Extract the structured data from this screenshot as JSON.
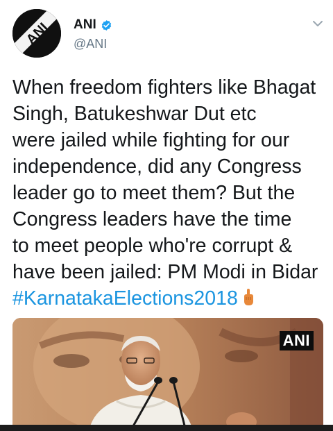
{
  "account": {
    "name": "ANI",
    "handle": "@ANI",
    "avatar_text": "ANI",
    "verified": true
  },
  "tweet": {
    "lines": [
      "When freedom fighters like Bhagat",
      "Singh, Batukeshwar Dut etc",
      "were jailed while fighting for our",
      "independence, did any Congress",
      "leader go to meet them? But the",
      "Congress leaders have the time",
      "to meet people who're corrupt &",
      "have been jailed: PM Modi in Bidar"
    ],
    "hashtag": "#KarnatakaElections2018",
    "emoji": "pointing-finger-emoji"
  },
  "media": {
    "watermark": "ANI"
  },
  "colors": {
    "link": "#1b95e0",
    "verified": "#1da1f2",
    "text": "#14171a",
    "secondary": "#657786"
  }
}
